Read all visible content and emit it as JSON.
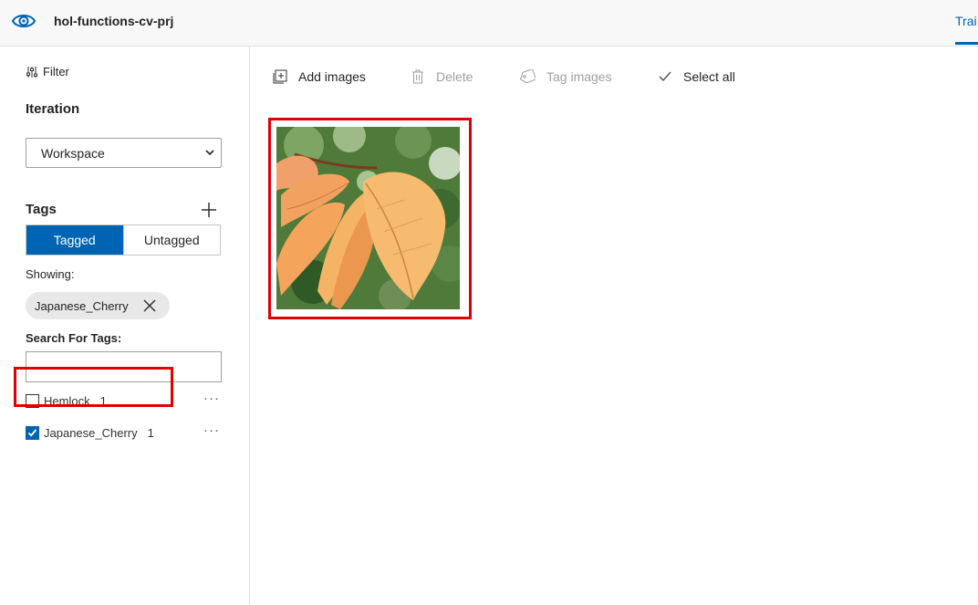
{
  "header": {
    "project_name": "hol-functions-cv-prj",
    "train_tab_label": "Trai",
    "app_icon": "eye-icon"
  },
  "sidebar": {
    "filter_label": "Filter",
    "iteration_title": "Iteration",
    "iteration_selected": "Workspace",
    "tags_title": "Tags",
    "tag_filter": {
      "tagged_label": "Tagged",
      "untagged_label": "Untagged",
      "selected": "Tagged"
    },
    "showing_label": "Showing:",
    "active_filter_chip": "Japanese_Cherry",
    "search_label": "Search For Tags:",
    "search_value": "",
    "tags": [
      {
        "name": "Hemlock",
        "count": "1",
        "checked": false
      },
      {
        "name": "Japanese_Cherry",
        "count": "1",
        "checked": true
      }
    ]
  },
  "toolbar": {
    "add_images_label": "Add images",
    "delete_label": "Delete",
    "tag_images_label": "Tag images",
    "select_all_label": "Select all"
  },
  "gallery": {
    "images": [
      {
        "subject": "orange cherry leaves"
      }
    ]
  },
  "colors": {
    "accent": "#0064b4",
    "highlight": "#e00000",
    "disabled_text": "#a19f9d"
  }
}
